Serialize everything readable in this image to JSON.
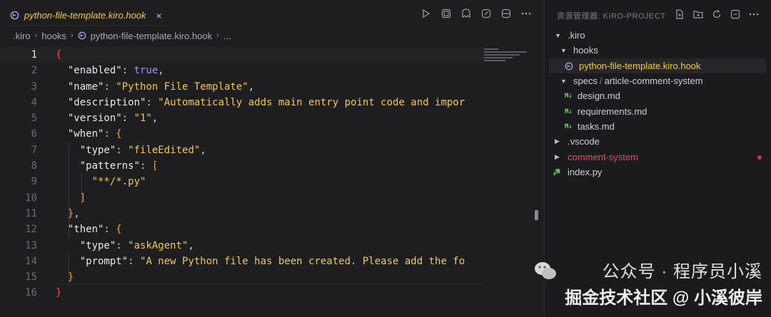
{
  "tab": {
    "title": "python-file-template.kiro.hook",
    "close": "×"
  },
  "breadcrumb": [
    ".kiro",
    "hooks",
    "python-file-template.kiro.hook",
    "..."
  ],
  "editor": {
    "line_numbers": [
      "1",
      "2",
      "3",
      "4",
      "5",
      "6",
      "7",
      "8",
      "9",
      "10",
      "11",
      "12",
      "13",
      "14",
      "15",
      "16"
    ]
  },
  "code": {
    "l1": "{",
    "l2_key": "\"enabled\"",
    "l2_val": "true",
    "l3_key": "\"name\"",
    "l3_val": "\"Python File Template\"",
    "l4_key": "\"description\"",
    "l4_val": "\"Automatically adds main entry point code and impor",
    "l5_key": "\"version\"",
    "l5_val": "\"1\"",
    "l6_key": "\"when\"",
    "l7_key": "\"type\"",
    "l7_val": "\"fileEdited\"",
    "l8_key": "\"patterns\"",
    "l9_val": "\"**/*.py\"",
    "l10": "]",
    "l11": "}",
    "l12_key": "\"then\"",
    "l13_key": "\"type\"",
    "l13_val": "\"askAgent\"",
    "l14_key": "\"prompt\"",
    "l14_val": "\"A new Python file has been created. Please add the fo",
    "l15": "}",
    "l16": "}"
  },
  "explorer": {
    "header": "资源管理器: KIRO-PROJECT",
    "items": [
      {
        "label": ".kiro"
      },
      {
        "label": "hooks"
      },
      {
        "label": "python-file-template.kiro.hook"
      },
      {
        "label": "specs",
        "sub": "article-comment-system"
      },
      {
        "label": "design.md"
      },
      {
        "label": "requirements.md"
      },
      {
        "label": "tasks.md"
      },
      {
        "label": ".vscode"
      },
      {
        "label": "comment-system"
      },
      {
        "label": "index.py"
      }
    ]
  },
  "watermark": {
    "line1": "公众号 · 程序员小溪",
    "line2": "掘金技术社区 @ 小溪彼岸"
  },
  "colors": {
    "tab_title": "#f2c94c",
    "string": "#f3c65a",
    "boolean": "#b48ef5",
    "modified": "#c0394b",
    "markdown_icon": "#7cd46c"
  }
}
